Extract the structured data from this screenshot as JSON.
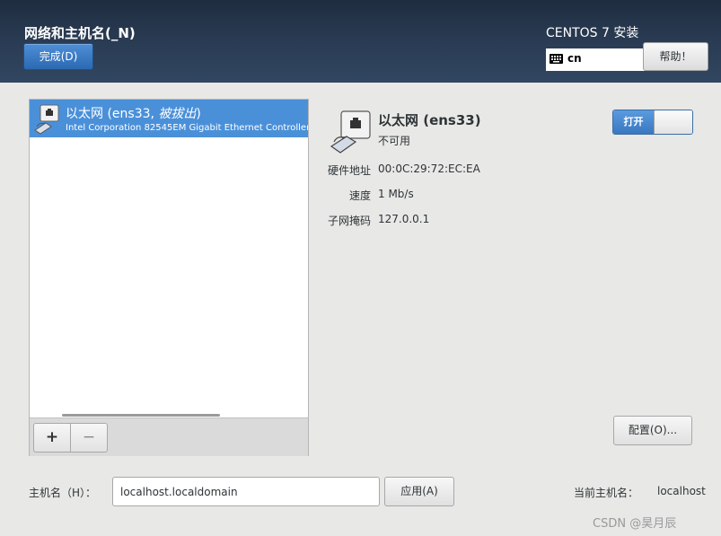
{
  "header": {
    "title": "网络和主机名(_N)",
    "done_label": "完成(D)",
    "product": "CENTOS 7 安装",
    "keyboard_layout": "cn",
    "help_label": "帮助！"
  },
  "device_list": {
    "items": [
      {
        "name_prefix": "以太网 (ens33, ",
        "state": "被拔出",
        "name_suffix": ")",
        "description": "Intel Corporation 82545EM Gigabit Ethernet Controller (",
        "selected": true
      }
    ],
    "add_label": "+",
    "remove_label": "−"
  },
  "details": {
    "name": "以太网 (ens33)",
    "status": "不可用",
    "properties": [
      {
        "label": "硬件地址",
        "value": "00:0C:29:72:EC:EA"
      },
      {
        "label": "速度",
        "value": "1 Mb/s"
      },
      {
        "label": "子网掩码",
        "value": "127.0.0.1"
      }
    ],
    "toggle_label": "打开",
    "toggle_on": true,
    "configure_label": "配置(O)..."
  },
  "hostname": {
    "label": "主机名（H）：",
    "value": "localhost.localdomain",
    "apply_label": "应用(A)",
    "current_label": "当前主机名：",
    "current_value": "localhost"
  },
  "watermark": "CSDN @昊月辰",
  "colors": {
    "accent": "#4a90d9",
    "header_dark": "#1e2d40",
    "header_light": "#314661"
  }
}
